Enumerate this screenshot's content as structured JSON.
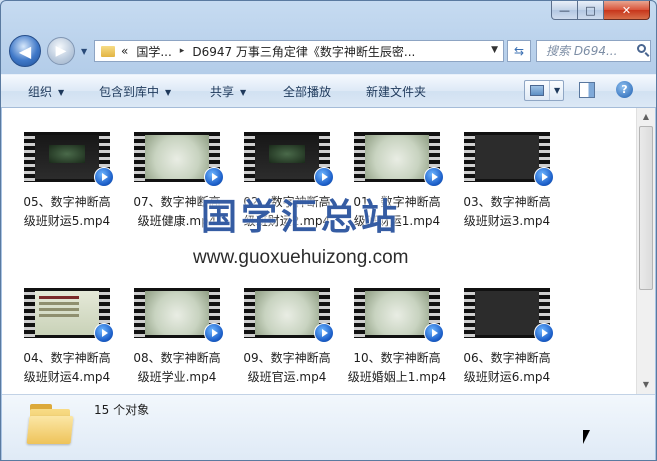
{
  "window": {
    "min_label": "—",
    "max_label": "□",
    "close_label": "✕"
  },
  "nav": {
    "back_glyph": "◀",
    "forward_glyph": "▶",
    "address": {
      "root_chevron": "«",
      "segments": [
        "国学...",
        "D6947 万事三角定律《数字神断生辰密..."
      ],
      "separator": "▸"
    },
    "search_placeholder": "搜索 D694..."
  },
  "toolbar": {
    "organize": "组织",
    "include_library": "包含到库中",
    "share": "共享",
    "play_all": "全部播放",
    "new_folder": "新建文件夹",
    "help": "?"
  },
  "files": [
    {
      "name": "05、数字神断高\n级班财运5.mp4",
      "thumb": "ppt"
    },
    {
      "name": "07、数字神断高\n级班健康.mp4",
      "thumb": "light"
    },
    {
      "name": "02、数字神断高\n级班财运2.mp4",
      "thumb": "ppt"
    },
    {
      "name": "01、数字神断高\n级班财运1.mp4",
      "thumb": "light"
    },
    {
      "name": "03、数字神断高\n级班财运3.mp4",
      "thumb": "dark"
    },
    {
      "name": "04、数字神断高\n级班财运4.mp4",
      "thumb": "slide"
    },
    {
      "name": "08、数字神断高\n级班学业.mp4",
      "thumb": "light"
    },
    {
      "name": "09、数字神断高\n级班官运.mp4",
      "thumb": "light"
    },
    {
      "name": "10、数字神断高\n级班婚姻上1.mp4",
      "thumb": "light"
    },
    {
      "name": "06、数字神断高\n级班财运6.mp4",
      "thumb": "dark"
    }
  ],
  "watermark": {
    "text": "国学汇总站",
    "url": "www.guoxuehuizong.com"
  },
  "details": {
    "count": "15 个对象"
  },
  "colors": {
    "watermark": "#1946a0",
    "toolbar_text": "#1e395b"
  }
}
